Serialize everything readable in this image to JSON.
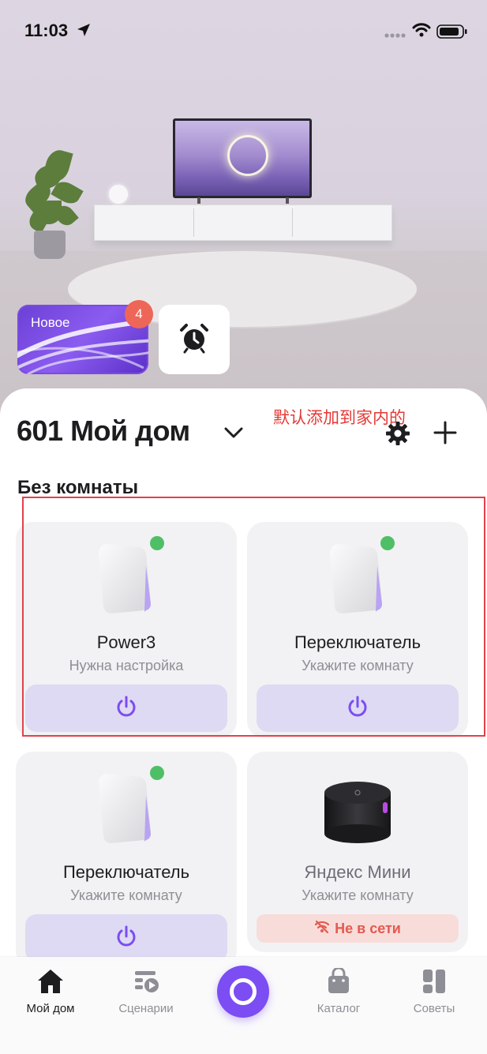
{
  "status_bar": {
    "time": "11:03"
  },
  "stories": {
    "new_label": "Новое",
    "new_badge": "4"
  },
  "home": {
    "title": "601 Мой дом"
  },
  "annotation": "默认添加到家内的",
  "section": {
    "title": "Без комнаты"
  },
  "devices": [
    {
      "name": "Power3",
      "status": "Нужна настройка",
      "online": true
    },
    {
      "name": "Переключатель",
      "status": "Укажите комнату",
      "online": true
    },
    {
      "name": "Переключатель",
      "status": "Укажите комнату",
      "online": true
    },
    {
      "name": "Яндекс Мини",
      "status": "Укажите комнату",
      "online": false,
      "offline_label": "Не в сети"
    }
  ],
  "tabbar": {
    "items": [
      {
        "label": "Мой дом",
        "active": true
      },
      {
        "label": "Сценарии",
        "active": false
      },
      {
        "label": "Каталог",
        "active": false
      },
      {
        "label": "Советы",
        "active": false
      }
    ]
  },
  "colors": {
    "accent": "#7b4df3",
    "online": "#4fbf67",
    "offline": "#e45a4f",
    "highlight": "#e2424b",
    "badge": "#ee6658"
  }
}
